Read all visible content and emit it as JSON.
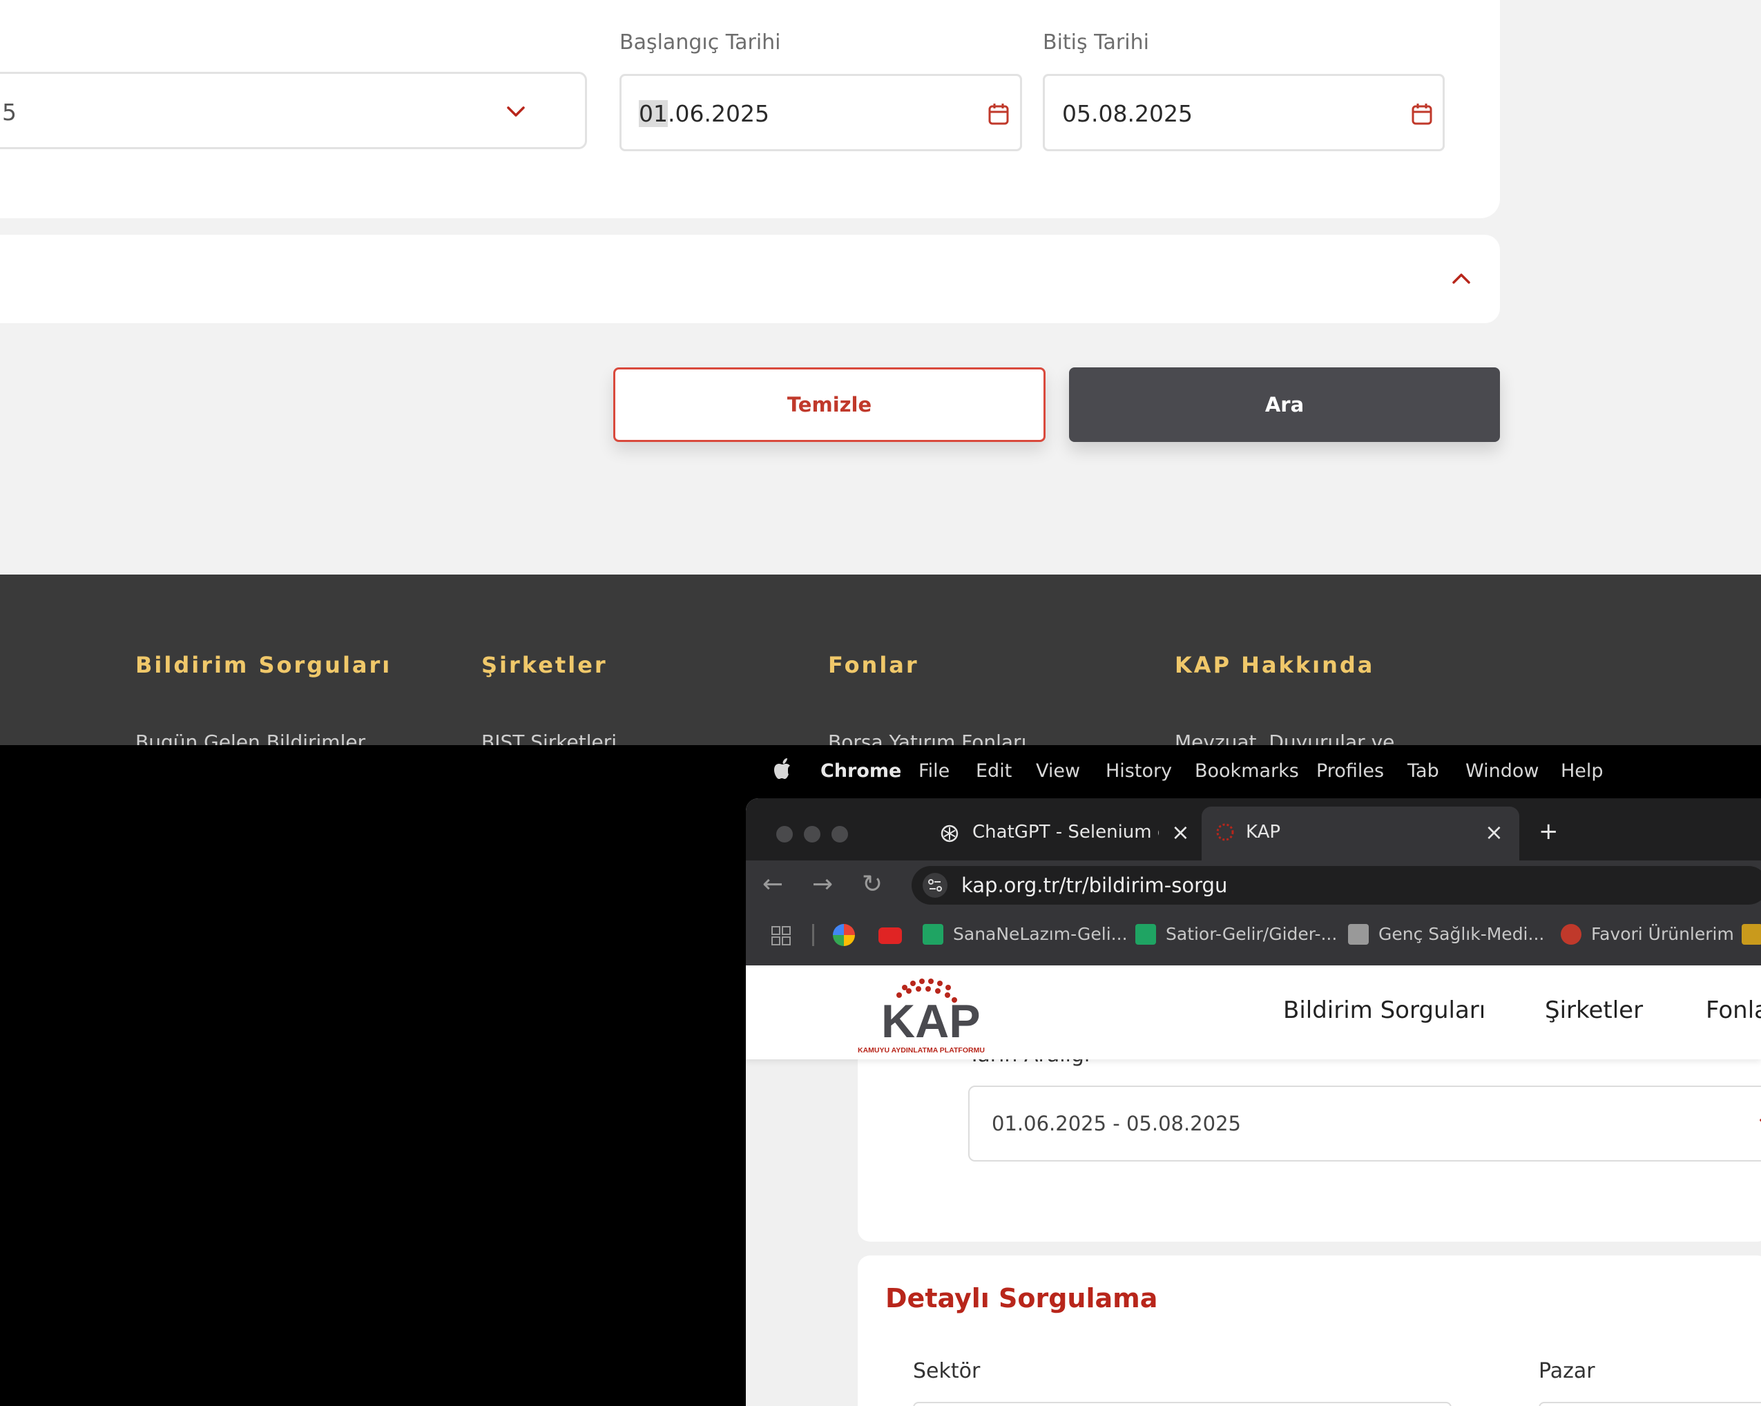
{
  "zoomed_page": {
    "partial_select_value": "5",
    "start_date": {
      "label": "Başlangıç Tarihi",
      "value_highlight": "01",
      "value_rest": ".06.2025"
    },
    "end_date": {
      "label": "Bitiş Tarihi",
      "value": "05.08.2025"
    },
    "buttons": {
      "clear": "Temizle",
      "search": "Ara"
    },
    "footer": {
      "columns": [
        {
          "heading": "Bildirim Sorguları",
          "first_link": "Bugün Gelen Bildirimler"
        },
        {
          "heading": "Şirketler",
          "first_link": "BIST Şirketleri"
        },
        {
          "heading": "Fonlar",
          "first_link": "Borsa Yatırım Fonları"
        },
        {
          "heading": "KAP Hakkında",
          "first_link": "Mevzuat, Duyurular ve"
        }
      ]
    }
  },
  "menubar": {
    "app": "Chrome",
    "items": [
      "File",
      "Edit",
      "View",
      "History",
      "Bookmarks",
      "Profiles",
      "Tab",
      "Window",
      "Help"
    ]
  },
  "browser": {
    "tabs": [
      {
        "title": "ChatGPT - Selenium öğreniyo",
        "icon": "chatgpt-icon"
      },
      {
        "title": "KAP",
        "icon": "kap-favicon"
      }
    ],
    "url": "kap.org.tr/tr/bildirim-sorgu",
    "bookmarks": [
      "SanaNeLazım-Geli...",
      "Satior-Gelir/Gider-...",
      "Genç Sağlık-Medi...",
      "Favori Ürünlerim"
    ]
  },
  "site": {
    "logo_text": "KAP",
    "logo_subtitle": "KAMUYU AYDINLATMA PLATFORMU",
    "nav": [
      "Bildirim Sorguları",
      "Şirketler",
      "Fonla"
    ],
    "date_range_label": "Tarih Aralığı",
    "date_range_value": "01.06.2025 - 05.08.2025",
    "detail_title": "Detaylı Sorgulama",
    "sector_label": "Sektör",
    "market_label": "Pazar"
  },
  "colors": {
    "accent_red": "#b8261b",
    "footer_gold": "#f0c86a",
    "dark_button": "#4a4a4f"
  }
}
